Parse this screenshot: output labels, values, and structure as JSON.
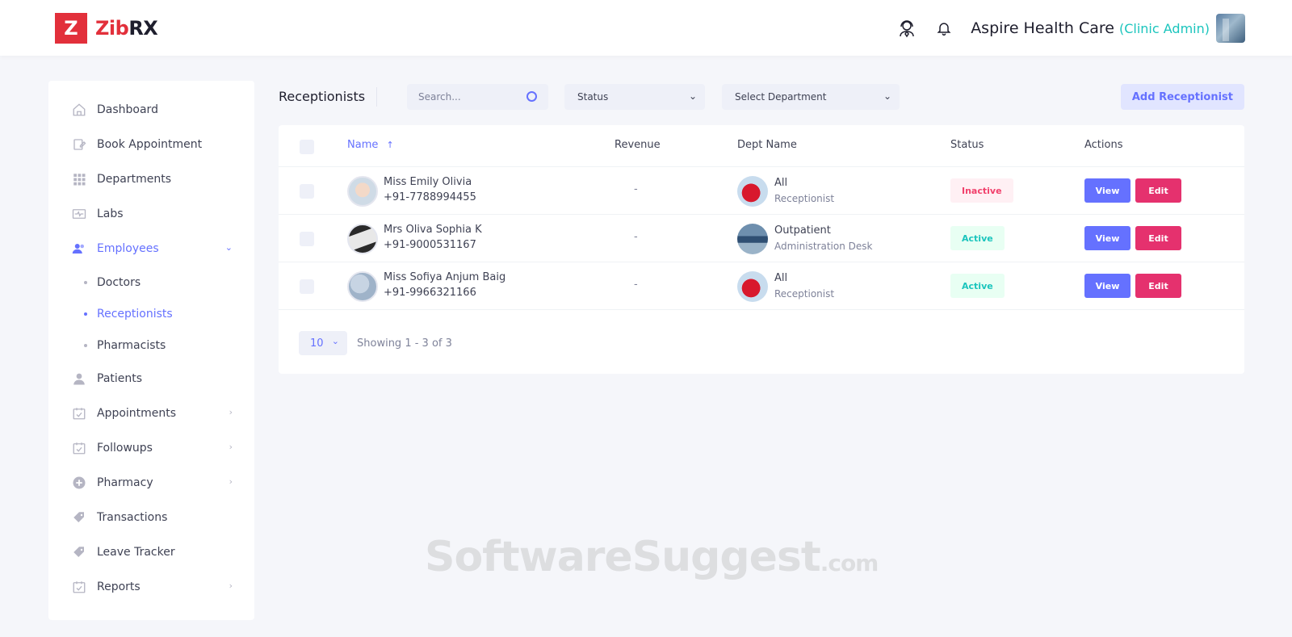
{
  "brand": {
    "logo_letter": "Z",
    "name_part1": "Zib",
    "name_part2": "RX"
  },
  "header": {
    "clinic_name": "Aspire Health Care",
    "role": "(Clinic Admin)"
  },
  "sidebar": {
    "items": [
      {
        "label": "Dashboard",
        "icon": "home-icon"
      },
      {
        "label": "Book Appointment",
        "icon": "edit-icon"
      },
      {
        "label": "Departments",
        "icon": "grid-icon"
      },
      {
        "label": "Labs",
        "icon": "lab-icon"
      },
      {
        "label": "Employees",
        "icon": "users-icon",
        "expanded": true
      },
      {
        "label": "Patients",
        "icon": "user-icon"
      },
      {
        "label": "Appointments",
        "icon": "calendar-check-icon"
      },
      {
        "label": "Followups",
        "icon": "calendar-check-icon"
      },
      {
        "label": "Pharmacy",
        "icon": "plus-circle-icon"
      },
      {
        "label": "Transactions",
        "icon": "tag-icon"
      },
      {
        "label": "Leave Tracker",
        "icon": "tag-icon"
      },
      {
        "label": "Reports",
        "icon": "calendar-check-icon"
      }
    ],
    "employee_sub": [
      {
        "label": "Doctors"
      },
      {
        "label": "Receptionists",
        "active": true
      },
      {
        "label": "Pharmacists"
      }
    ]
  },
  "toolbar": {
    "title": "Receptionists",
    "search_placeholder": "Search...",
    "status_select": "Status",
    "department_select": "Select Department",
    "add_button": "Add Receptionist"
  },
  "table": {
    "columns": {
      "name": "Name",
      "sort_arrow": "↑",
      "revenue": "Revenue",
      "dept": "Dept Name",
      "status": "Status",
      "actions": "Actions"
    },
    "rows": [
      {
        "name": "Miss Emily Olivia",
        "phone": "+91-7788994455",
        "revenue": "-",
        "dept": "All",
        "dept_sub": "Receptionist",
        "status": "Inactive",
        "view": "View",
        "edit": "Edit"
      },
      {
        "name": "Mrs Oliva Sophia K",
        "phone": "+91-9000531167",
        "revenue": "-",
        "dept": "Outpatient",
        "dept_sub": "Administration Desk",
        "status": "Active",
        "view": "View",
        "edit": "Edit"
      },
      {
        "name": "Miss Sofiya Anjum Baig",
        "phone": "+91-9966321166",
        "revenue": "-",
        "dept": "All",
        "dept_sub": "Receptionist",
        "status": "Active",
        "view": "View",
        "edit": "Edit"
      }
    ]
  },
  "pagination": {
    "per_page": "10",
    "showing": "Showing 1 - 3 of 3"
  },
  "watermark": {
    "main": "SoftwareSuggest",
    "suffix": ".com"
  },
  "colors": {
    "accent": "#6571ff",
    "brand_red": "#e2303b",
    "edit_pink": "#e5316e",
    "active_teal": "#1bc5bd",
    "inactive_red": "#f1416c"
  }
}
